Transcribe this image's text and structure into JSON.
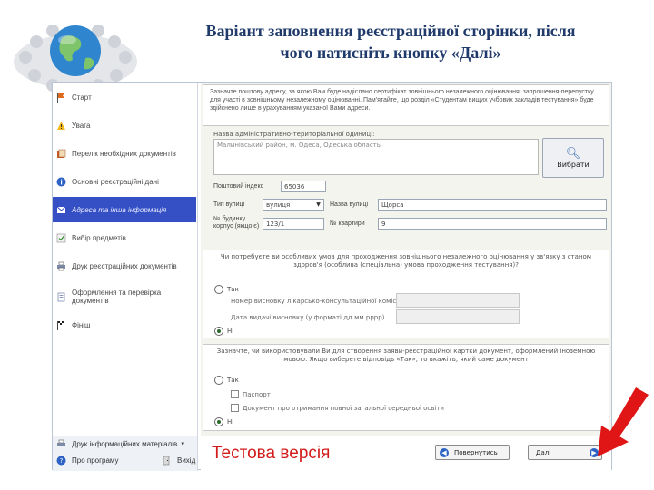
{
  "slide": {
    "title_line1": "Варіант заповнення реєстраційної сторінки, після",
    "title_line2": "чого натисніть кнопку «Далі»"
  },
  "sidebar": {
    "items": [
      {
        "label": "Старт",
        "icon": "flag-icon"
      },
      {
        "label": "Увага",
        "icon": "warning-icon"
      },
      {
        "label": "Перелік необхідних документів",
        "icon": "documents-icon"
      },
      {
        "label": "Основні реєстраційні дані",
        "icon": "info-icon"
      },
      {
        "label": "Адреса та інша інформація",
        "icon": "address-icon",
        "active": true
      },
      {
        "label": "Вибір предметів",
        "icon": "subjects-icon"
      },
      {
        "label": "Друк реєстраційних документів",
        "icon": "print-icon"
      },
      {
        "label": "Оформлення та перевірка документів",
        "icon": "check-icon"
      },
      {
        "label": "Фініш",
        "icon": "finish-flag-icon"
      }
    ]
  },
  "bottom_bar": {
    "materials_label": "Друк інформаційних матеріалів",
    "help_label": "Про програму",
    "exit_label": "Вихід"
  },
  "notice": {
    "text": "Зазначте поштову адресу, за якою Вам буде надіслано сертифікат зовнішнього незалежного оцінювання, запрошення-перепустку для участі в зовнішньому незалежному оцінюванні. Пам'ятайте, що розділ «Студентам вищих учбових закладів тестування» буде здійснено лише в урахуванням указаної Вами адреси."
  },
  "address": {
    "school_label": "Назва адміністративно-територіальної одиниці:",
    "school_value": "Малинівський район, м. Одеса, Одеська область",
    "select_button": "Вибрати",
    "postal_label": "Поштовий індекс",
    "postal_value": "65036",
    "street_type_label": "Тип вулиці",
    "street_type_value": "вулиця",
    "street_name_label": "Назва вулиці",
    "street_name_value": "Щорса",
    "house_label": "№ будинку корпус (якщо є)",
    "house_value": "123/1",
    "apartment_label": "№ квартири",
    "apartment_value": "9"
  },
  "special_conditions": {
    "question": "Чи потребуєте ви особливих умов для проходження зовнішнього незалежного оцінювання у зв'язку з станом здоров'я (особлива (спеціальна) умова проходження тестування)?",
    "yes_label": "Так",
    "field1_label": "Номер висновку лікарсько-консультаційної комісії",
    "field2_label": "Дата видачі висновку (у форматі дд.мм.рррр)",
    "no_label": "Ні",
    "selected": "no"
  },
  "documents": {
    "question": "Зазначте, чи використовували Ви для створення заяви-реєстраційної картки документ, оформлений іноземною мовою. Якщо виберете відповідь «Так», то вкажіть, який саме документ",
    "yes_label": "Так",
    "option1_label": "Паспорт",
    "option2_label": "Документ про отримання повної загальної середньої освіти",
    "no_label": "Ні",
    "selected": "no"
  },
  "footer": {
    "test_version": "Тестова версія",
    "back_button": "Повернутись",
    "next_button": "Далі"
  },
  "colors": {
    "accent_blue": "#3550c4",
    "test_red": "#d21b1b",
    "arrow_red": "#e01515"
  }
}
